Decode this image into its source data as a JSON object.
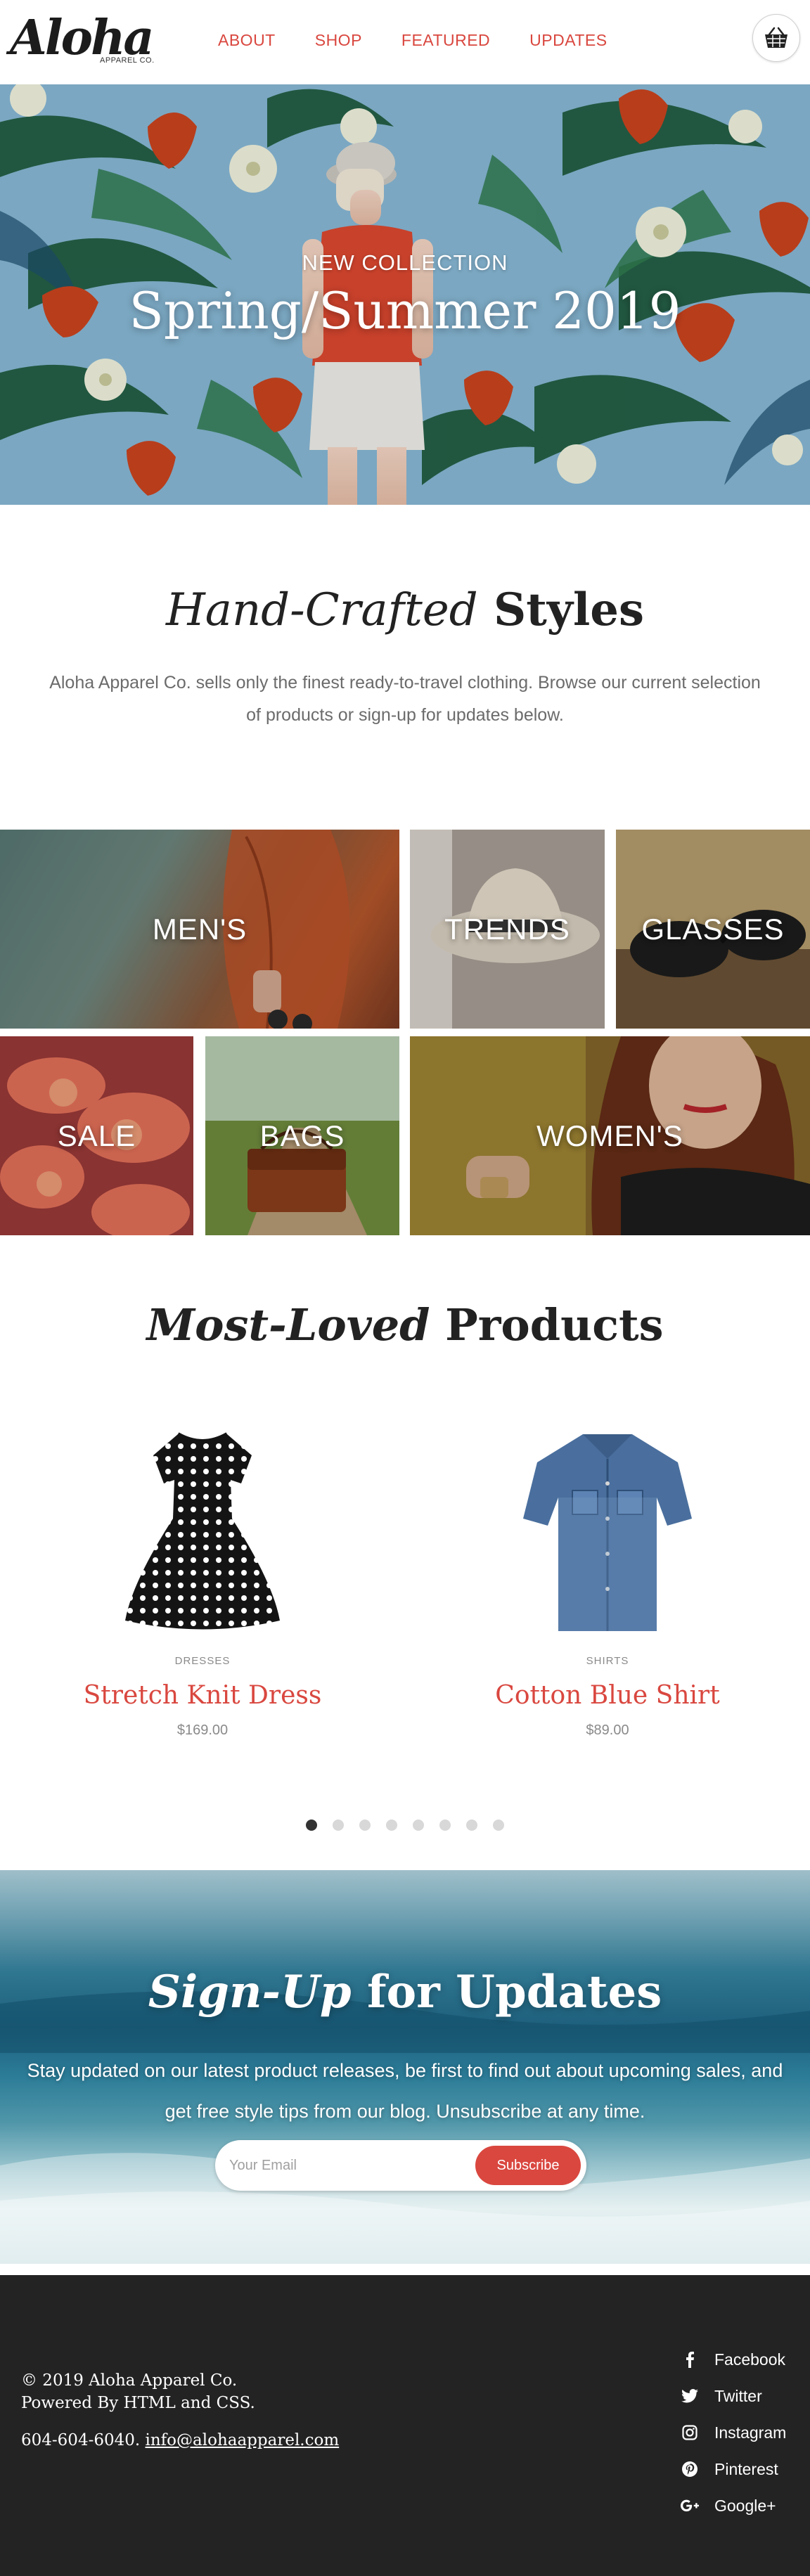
{
  "header": {
    "logo_text": "Aloha",
    "logo_sub": "APPAREL CO.",
    "nav": [
      "ABOUT",
      "SHOP",
      "FEATURED",
      "UPDATES"
    ],
    "cart_icon": "basket-icon"
  },
  "hero": {
    "kicker": "NEW COLLECTION",
    "title": "Spring/Summer 2019"
  },
  "intro": {
    "title_italic": "Hand-Crafted",
    "title_bold": "Styles",
    "text": "Aloha Apparel Co. sells only the finest ready-to-travel clothing. Browse our current selection of products or sign-up for updates below."
  },
  "categories": [
    {
      "label": "MEN'S"
    },
    {
      "label": "TRENDS"
    },
    {
      "label": "GLASSES"
    },
    {
      "label": "SALE"
    },
    {
      "label": "BAGS"
    },
    {
      "label": "WOMEN'S"
    }
  ],
  "products": {
    "title_italic": "Most-Loved",
    "title_bold": "Products",
    "items": [
      {
        "category": "DRESSES",
        "name": "Stretch Knit Dress",
        "price": "$169.00"
      },
      {
        "category": "SHIRTS",
        "name": "Cotton Blue Shirt",
        "price": "$89.00"
      }
    ],
    "carousel_pages": 8,
    "carousel_active": 1
  },
  "signup": {
    "title_italic": "Sign-Up",
    "title_bold": "for Updates",
    "text_line1": "Stay updated on our latest product releases, be first to find out about upcoming sales, and",
    "text_line2": "get free style tips from our blog. Unsubscribe at any time.",
    "email_placeholder": "Your Email",
    "button_label": "Subscribe"
  },
  "footer": {
    "copyright": "© 2019 Aloha Apparel Co.",
    "powered": "Powered By HTML and CSS.",
    "phone": "604-604-6040.",
    "email": "info@alohaapparel.com",
    "social": [
      {
        "label": "Facebook",
        "icon": "facebook-icon"
      },
      {
        "label": "Twitter",
        "icon": "twitter-icon"
      },
      {
        "label": "Instagram",
        "icon": "instagram-icon"
      },
      {
        "label": "Pinterest",
        "icon": "pinterest-icon"
      },
      {
        "label": "Google+",
        "icon": "google-plus-icon"
      }
    ]
  },
  "colors": {
    "accent": "#d9473f",
    "text_dark": "#222222",
    "text_muted": "#6b6b6b",
    "footer_bg": "#232324"
  }
}
